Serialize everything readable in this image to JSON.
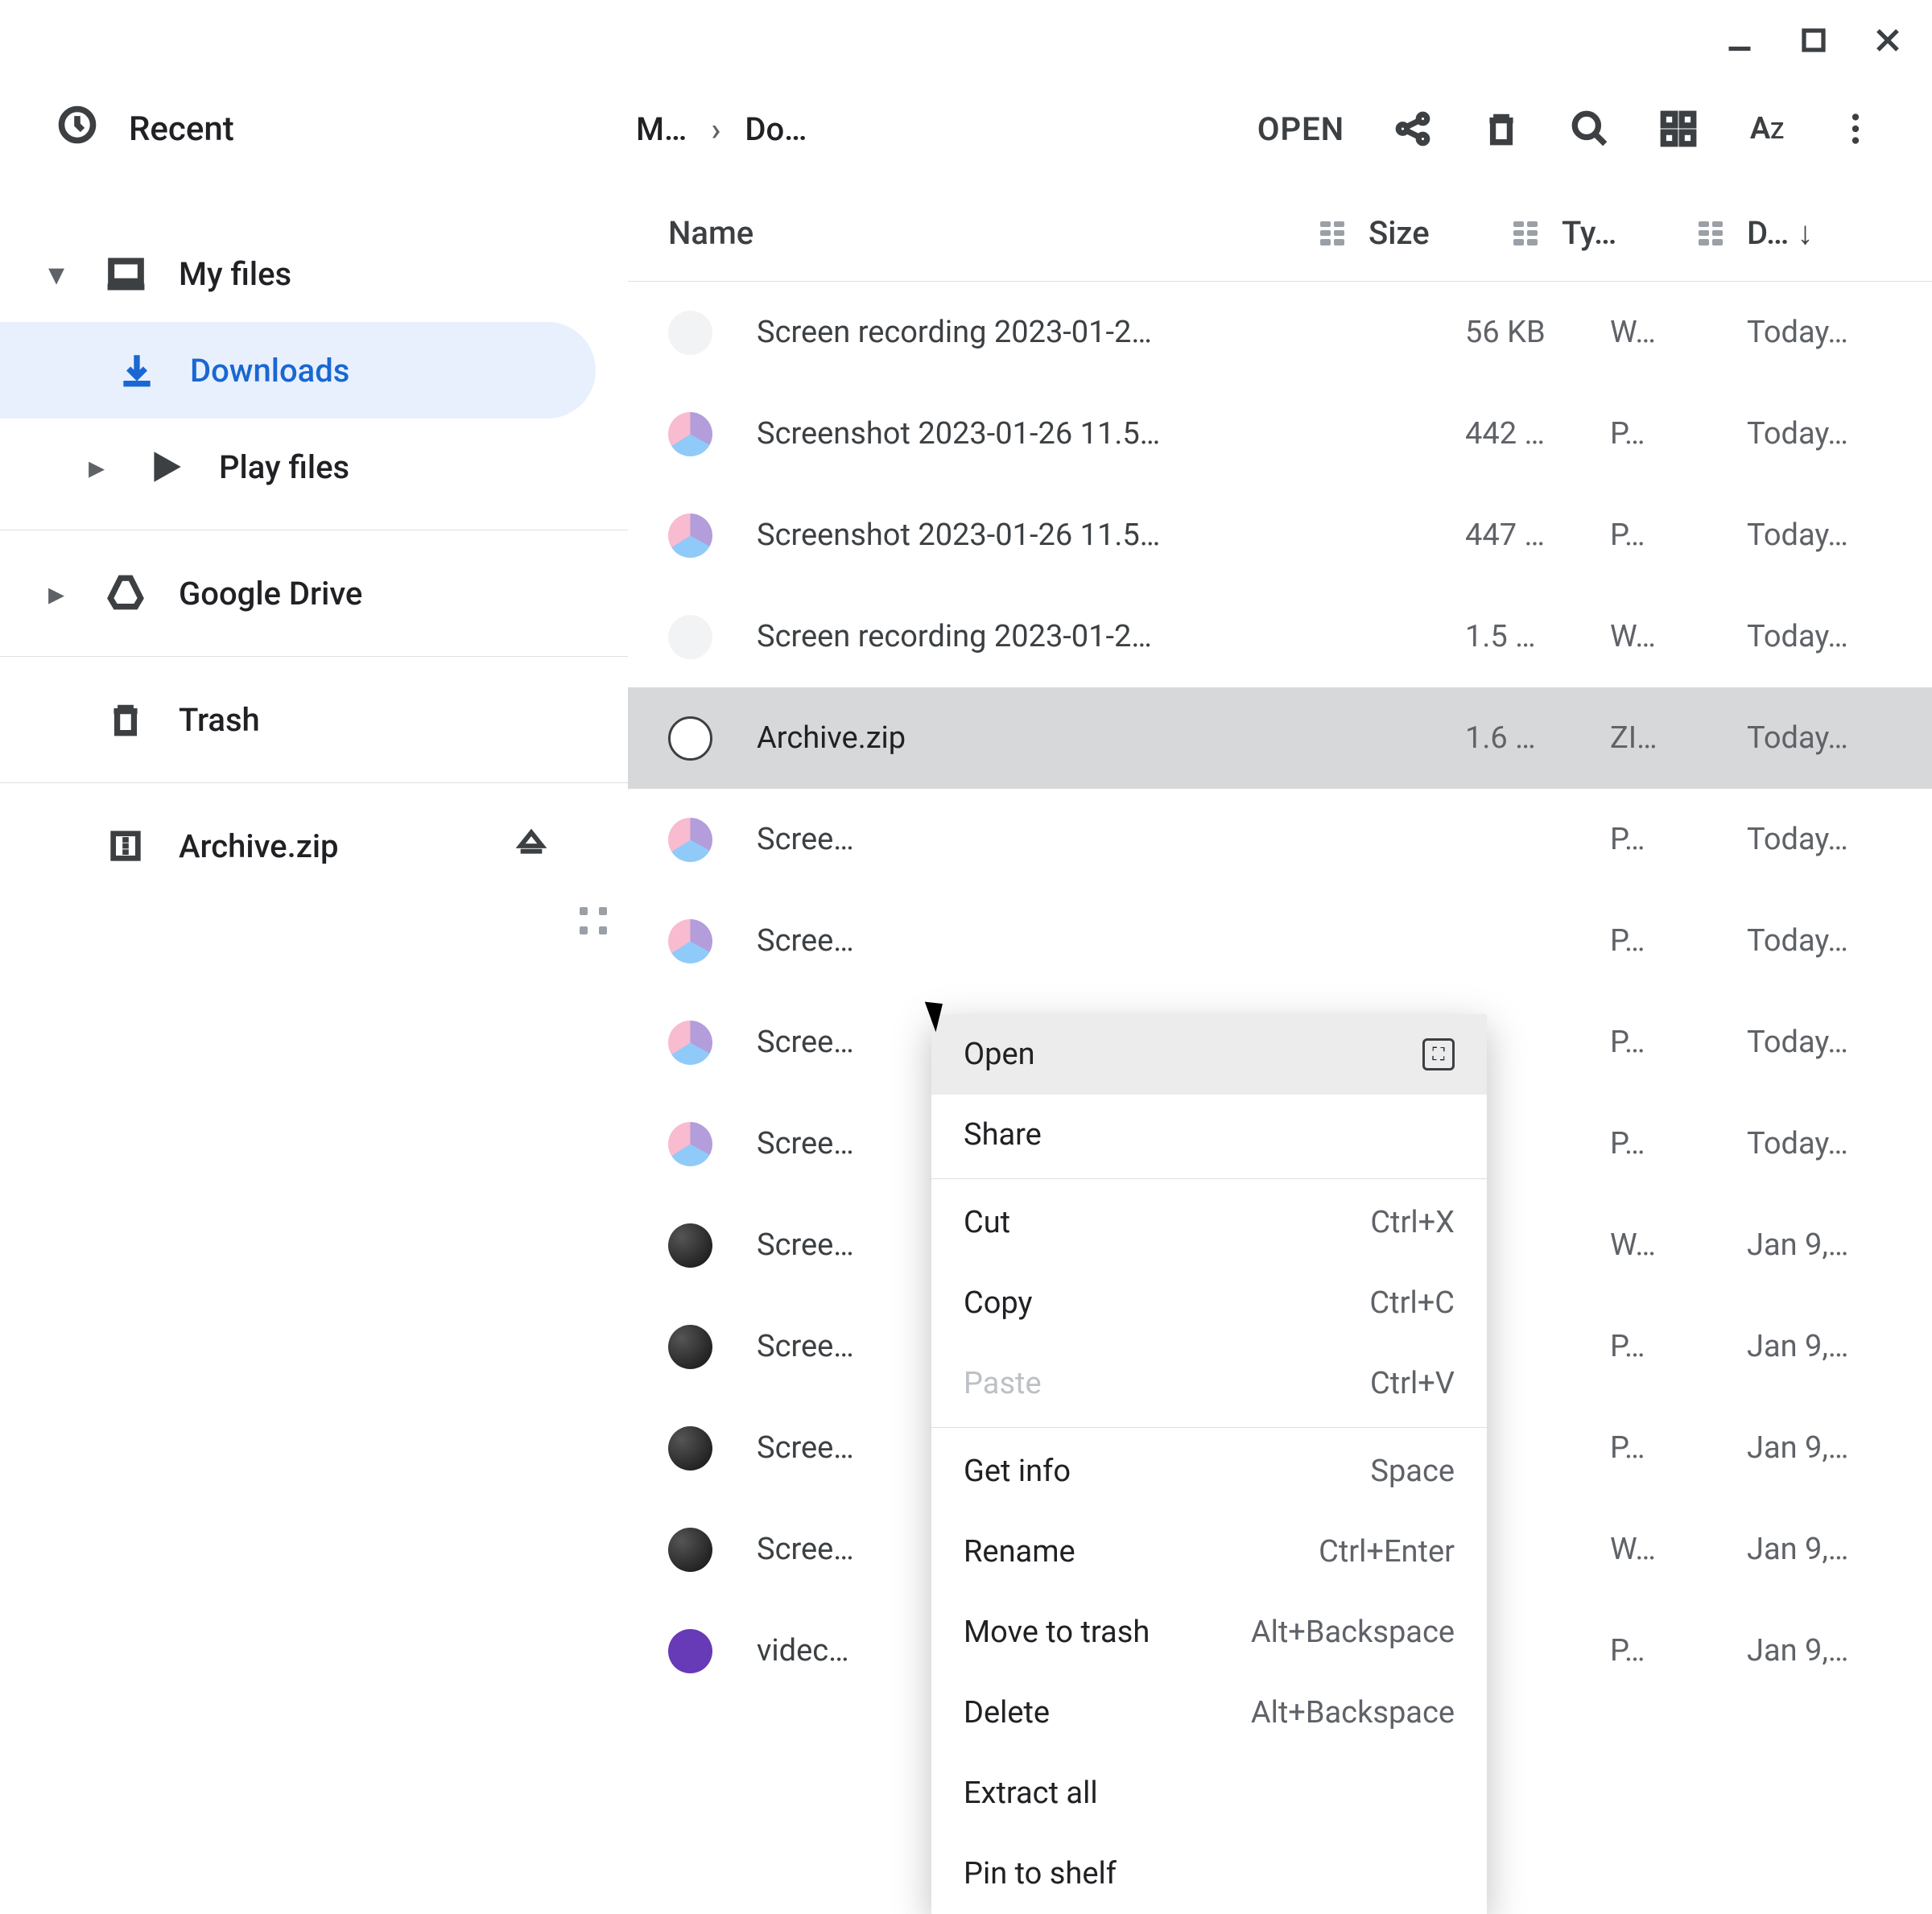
{
  "window": {
    "breadcrumb1": "M…",
    "breadcrumb2": "Do…",
    "open_button": "OPEN"
  },
  "sidebar": {
    "recent": "Recent",
    "myfiles": "My files",
    "downloads": "Downloads",
    "playfiles": "Play files",
    "googledrive": "Google Drive",
    "trash": "Trash",
    "archive": "Archive.zip"
  },
  "columns": {
    "name": "Name",
    "size": "Size",
    "type": "Ty…",
    "date": "D…"
  },
  "files": [
    {
      "name": "Screen recording 2023-01-2…",
      "size": "56 KB",
      "type": "W…",
      "date": "Today…",
      "icon": "fi-blank"
    },
    {
      "name": "Screenshot 2023-01-26 11.5…",
      "size": "442 …",
      "type": "P…",
      "date": "Today…",
      "icon": "fi-shot"
    },
    {
      "name": "Screenshot 2023-01-26 11.5…",
      "size": "447 …",
      "type": "P…",
      "date": "Today…",
      "icon": "fi-shot"
    },
    {
      "name": "Screen recording 2023-01-2…",
      "size": "1.5 …",
      "type": "W…",
      "date": "Today…",
      "icon": "fi-blank"
    },
    {
      "name": "Archive.zip",
      "size": "1.6 …",
      "type": "ZI…",
      "date": "Today…",
      "icon": "fi-arch",
      "selected": true
    },
    {
      "name": "Scree…",
      "size": "",
      "type": "P…",
      "date": "Today…",
      "icon": "fi-shot"
    },
    {
      "name": "Scree…",
      "size": "",
      "type": "P…",
      "date": "Today…",
      "icon": "fi-shot"
    },
    {
      "name": "Scree…",
      "size": "",
      "type": "P…",
      "date": "Today…",
      "icon": "fi-shot"
    },
    {
      "name": "Scree…",
      "size": "",
      "type": "P…",
      "date": "Today…",
      "icon": "fi-shot"
    },
    {
      "name": "Scree…",
      "size": "",
      "type": "W…",
      "date": "Jan 9,…",
      "icon": "fi-dark"
    },
    {
      "name": "Scree…",
      "size": "",
      "type": "P…",
      "date": "Jan 9,…",
      "icon": "fi-dark"
    },
    {
      "name": "Scree…",
      "size": "",
      "type": "P…",
      "date": "Jan 9,…",
      "icon": "fi-dark"
    },
    {
      "name": "Scree…",
      "size": "",
      "type": "W…",
      "date": "Jan 9,…",
      "icon": "fi-dark"
    },
    {
      "name": "videc…",
      "size": "",
      "type": "P…",
      "date": "Jan 9,…",
      "icon": "fi-vid"
    }
  ],
  "context_menu": [
    {
      "label": "Open",
      "hint": "expand",
      "highlight": true
    },
    {
      "label": "Share"
    },
    {
      "sep": true
    },
    {
      "label": "Cut",
      "hint": "Ctrl+X"
    },
    {
      "label": "Copy",
      "hint": "Ctrl+C"
    },
    {
      "label": "Paste",
      "hint": "Ctrl+V",
      "disabled": true
    },
    {
      "sep": true
    },
    {
      "label": "Get info",
      "hint": "Space"
    },
    {
      "label": "Rename",
      "hint": "Ctrl+Enter"
    },
    {
      "label": "Move to trash",
      "hint": "Alt+Backspace"
    },
    {
      "label": "Delete",
      "hint": "Alt+Backspace"
    },
    {
      "label": "Extract all"
    },
    {
      "label": "Pin to shelf"
    }
  ]
}
